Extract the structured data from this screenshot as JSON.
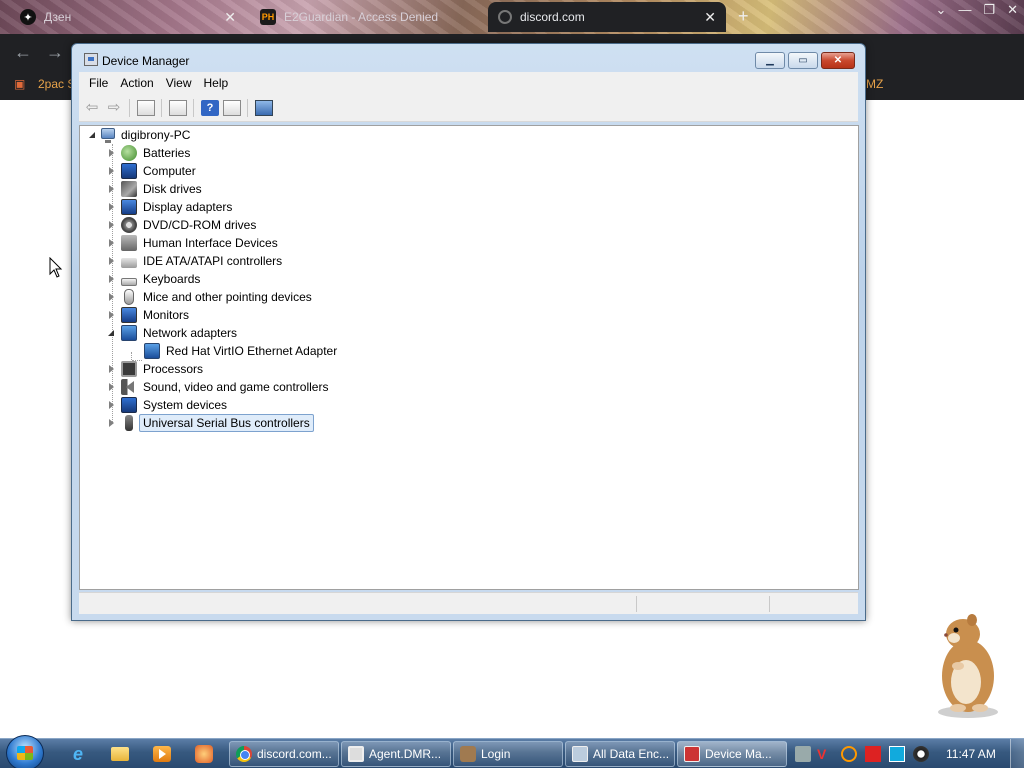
{
  "browser": {
    "tabs": [
      {
        "title": "Дзен",
        "active": false
      },
      {
        "title": "E2Guardian - Access Denied",
        "active": false
      },
      {
        "title": "discord.com",
        "active": true
      }
    ],
    "bookmarks": [
      "2pac S",
      "MZ"
    ]
  },
  "window": {
    "title": "Device Manager",
    "menu": [
      "File",
      "Action",
      "View",
      "Help"
    ],
    "toolbar_icons": [
      "back-icon",
      "forward-icon",
      "show-hide-console-tree-icon",
      "properties-icon",
      "help-icon",
      "action-pane-icon",
      "scan-hardware-icon"
    ]
  },
  "tree": {
    "root": "digibrony-PC",
    "categories": [
      {
        "label": "Batteries",
        "icon": "battery-icon",
        "expanded": false
      },
      {
        "label": "Computer",
        "icon": "computer-icon",
        "expanded": false
      },
      {
        "label": "Disk drives",
        "icon": "disk-drive-icon",
        "expanded": false
      },
      {
        "label": "Display adapters",
        "icon": "display-adapter-icon",
        "expanded": false
      },
      {
        "label": "DVD/CD-ROM drives",
        "icon": "dvd-drive-icon",
        "expanded": false
      },
      {
        "label": "Human Interface Devices",
        "icon": "hid-icon",
        "expanded": false
      },
      {
        "label": "IDE ATA/ATAPI controllers",
        "icon": "ide-controller-icon",
        "expanded": false
      },
      {
        "label": "Keyboards",
        "icon": "keyboard-icon",
        "expanded": false
      },
      {
        "label": "Mice and other pointing devices",
        "icon": "mouse-icon",
        "expanded": false
      },
      {
        "label": "Monitors",
        "icon": "monitor-icon",
        "expanded": false
      },
      {
        "label": "Network adapters",
        "icon": "network-adapter-icon",
        "expanded": true,
        "children": [
          "Red Hat VirtIO Ethernet Adapter"
        ]
      },
      {
        "label": "Processors",
        "icon": "processor-icon",
        "expanded": false
      },
      {
        "label": "Sound, video and game controllers",
        "icon": "sound-icon",
        "expanded": false
      },
      {
        "label": "System devices",
        "icon": "system-device-icon",
        "expanded": false
      },
      {
        "label": "Universal Serial Bus controllers",
        "icon": "usb-icon",
        "expanded": false,
        "selected": true
      }
    ]
  },
  "taskbar": {
    "tasks": [
      {
        "label": "discord.com...",
        "icon": "chrome-icon"
      },
      {
        "label": "Agent.DMR...",
        "icon": "app-window-icon"
      },
      {
        "label": "Login",
        "icon": "login-icon"
      },
      {
        "label": "All Data Enc...",
        "icon": "data-window-icon"
      },
      {
        "label": "Device Ma...",
        "icon": "device-manager-icon"
      }
    ],
    "clock": "11:47 AM"
  },
  "colors": {
    "selection_border": "#7da2ce",
    "selection_fill": "#dfecfa",
    "window_frame": "#bcd2ea",
    "taskbar": "#37597f"
  }
}
